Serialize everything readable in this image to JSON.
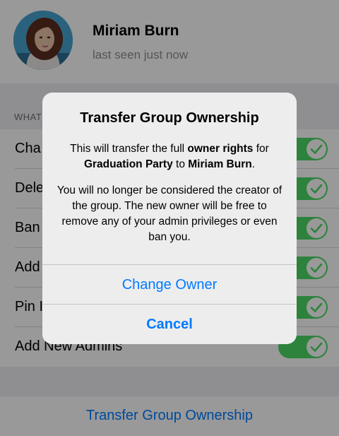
{
  "profile": {
    "name": "Miriam Burn",
    "status": "last seen just now"
  },
  "permissions": {
    "header": "WHAT",
    "items": [
      {
        "label": "Cha",
        "enabled": true
      },
      {
        "label": "Dele",
        "enabled": true
      },
      {
        "label": "Ban",
        "enabled": true
      },
      {
        "label": "Add",
        "enabled": true
      },
      {
        "label": "Pin I",
        "enabled": true
      },
      {
        "label": "Add New Admins",
        "enabled": true
      }
    ]
  },
  "transfer": {
    "label": "Transfer Group Ownership"
  },
  "alert": {
    "title": "Transfer Group Ownership",
    "msg1_a": "This will transfer the full ",
    "msg1_b": "owner rights",
    "msg1_c": " for ",
    "msg1_d": "Graduation Party",
    "msg1_e": " to ",
    "msg1_f": "Miriam Burn",
    "msg1_g": ".",
    "msg2": "You will no longer be considered the creator of the group. The new owner will be free to remove any of your admin privileges or even ban you.",
    "change_owner": "Change Owner",
    "cancel": "Cancel"
  },
  "colors": {
    "accent": "#007aff",
    "toggle_on": "#4cd964"
  }
}
